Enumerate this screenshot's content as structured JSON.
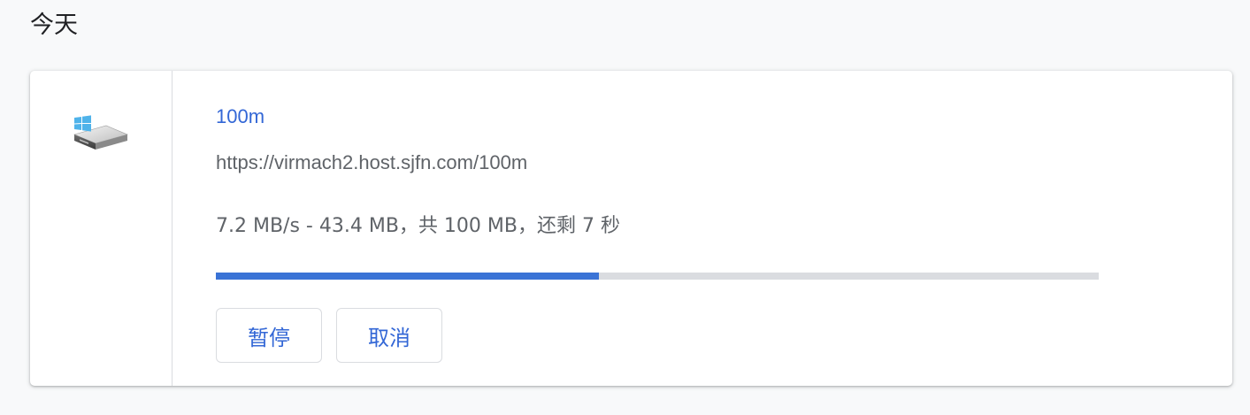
{
  "section": {
    "title": "今天"
  },
  "download": {
    "file_icon": "windows-drive-icon",
    "name": "100m",
    "url": "https://virmach2.host.sjfn.com/100m",
    "status": "7.2 MB/s - 43.4 MB，共 100 MB，还剩 7 秒",
    "progress_percent": 43.4,
    "buttons": {
      "pause": "暂停",
      "cancel": "取消"
    }
  },
  "colors": {
    "accent": "#3367d6",
    "progress_fill": "#3a73d6",
    "progress_track": "#dadce0",
    "background": "#f8f9fa"
  }
}
